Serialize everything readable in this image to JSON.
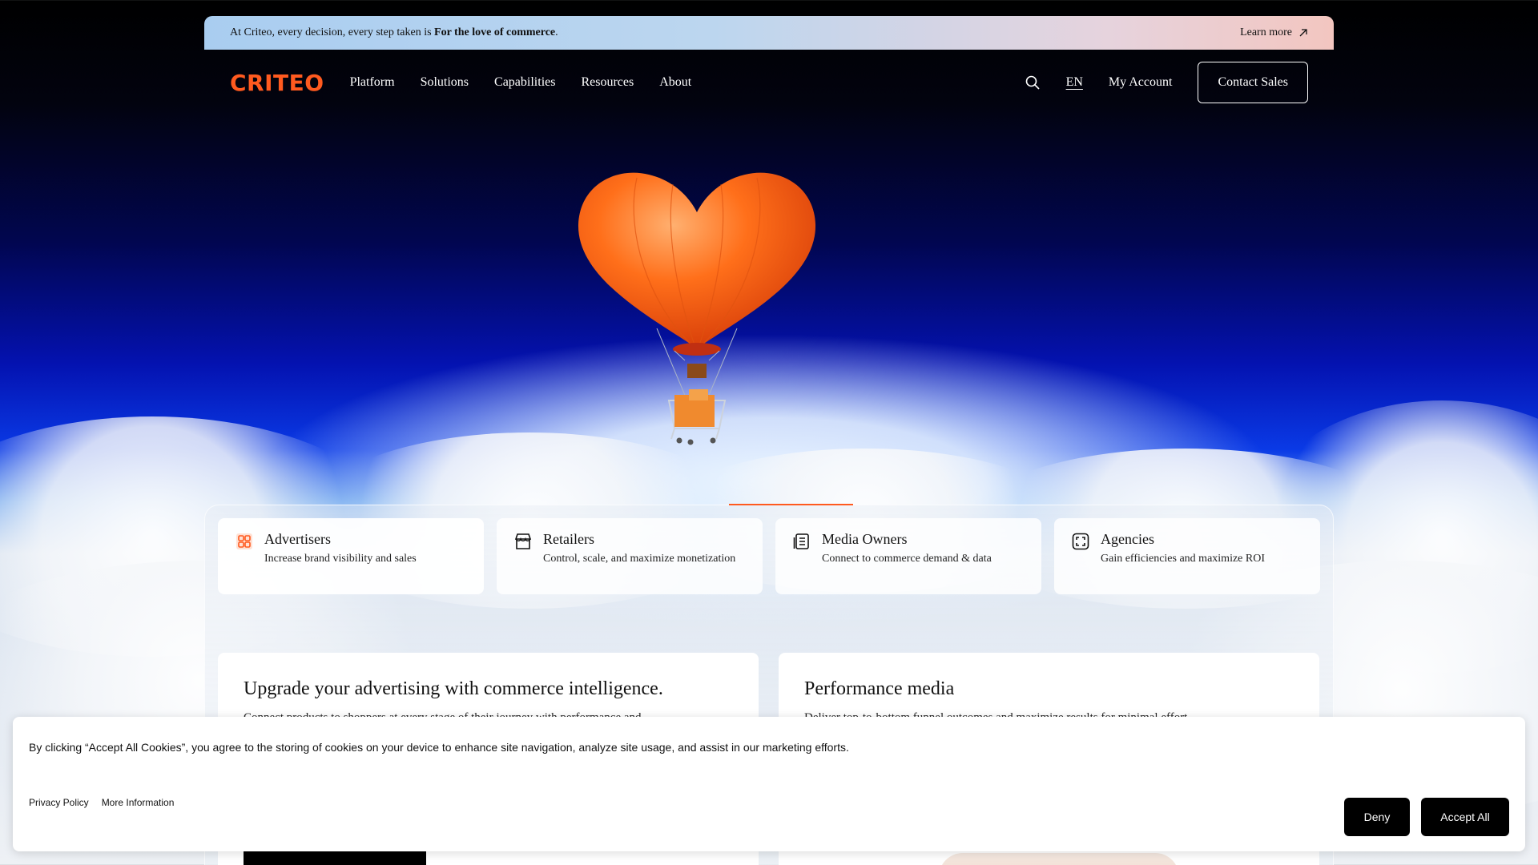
{
  "announcement": {
    "prefix": "At Criteo, every decision, every step taken is ",
    "emphasis": "For the love of commerce",
    "suffix": ".",
    "learn_more": "Learn more"
  },
  "nav": {
    "logo": "CRITEO",
    "links": [
      "Platform",
      "Solutions",
      "Capabilities",
      "Resources",
      "About"
    ],
    "language": "EN",
    "account": "My Account",
    "contact": "Contact Sales"
  },
  "audiences": [
    {
      "title": "Advertisers",
      "desc": "Increase brand visibility and sales",
      "icon": "grid-icon"
    },
    {
      "title": "Retailers",
      "desc": "Control, scale, and maximize monetization",
      "icon": "storefront-icon"
    },
    {
      "title": "Media Owners",
      "desc": "Connect to commerce demand & data",
      "icon": "document-icon"
    },
    {
      "title": "Agencies",
      "desc": "Gain efficiencies and maximize ROI",
      "icon": "frame-icon"
    }
  ],
  "cards": [
    {
      "title": "Upgrade your advertising with commerce intelligence.",
      "desc": "Connect products to shoppers at every stage of their journey with performance and"
    },
    {
      "title": "Performance media",
      "desc": "Deliver top-to-bottom funnel outcomes and maximize results for minimal effort."
    }
  ],
  "cookie": {
    "message": "By clicking “Accept All Cookies”, you agree to the storing of cookies on your device to enhance site navigation, analyze site usage, and assist in our marketing efforts.",
    "privacy": "Privacy Policy",
    "more_info": "More Information",
    "deny": "Deny",
    "accept": "Accept All"
  },
  "colors": {
    "brand": "#ff5a1f",
    "button_dark": "#000000"
  }
}
